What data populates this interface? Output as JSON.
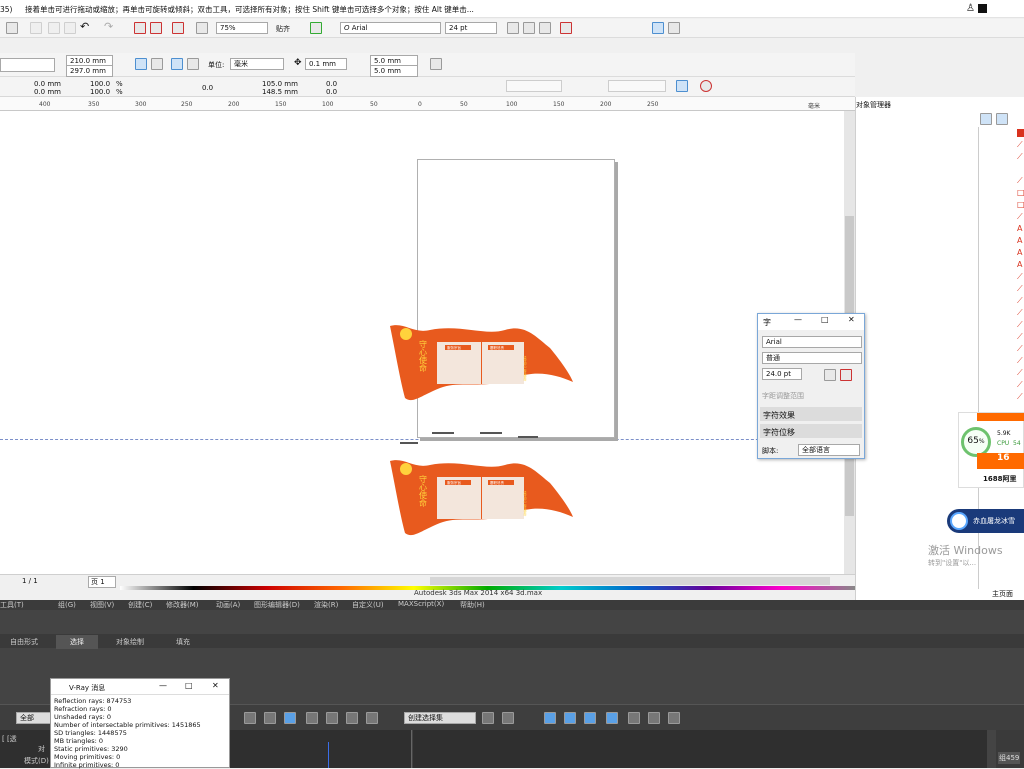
{
  "hint_bar": {
    "prefix": "35)",
    "text": "接着单击可进行拖动或缩放；再单击可旋转或倾斜；双击工具，可选择所有对象；按住 Shift 键单击可选择多个对象；按住 Alt 键单击..."
  },
  "toolbar1": {
    "zoom": "75%",
    "snap_label": "贴齐",
    "font": "Arial",
    "font_size": "24 pt",
    "font_glyph": "O"
  },
  "property_bar": {
    "width": "210.0 mm",
    "height": "297.0 mm",
    "units_label": "单位:",
    "units": "毫米",
    "nudge": "0.1 mm",
    "dup_x": "5.0 mm",
    "dup_y": "5.0 mm"
  },
  "toolbar3": {
    "x": "0.0 mm",
    "y": "0.0 mm",
    "sx": "100.0",
    "sy": "100.0",
    "pct": "%",
    "angle": "0.0",
    "px": "105.0 mm",
    "py": "148.5 mm",
    "r1": "0.0",
    "r2": "0.0"
  },
  "ruler": {
    "ticks": [
      "400",
      "350",
      "300",
      "250",
      "200",
      "150",
      "100",
      "50",
      "0",
      "50",
      "100",
      "150",
      "200",
      "250"
    ],
    "unit": "毫米"
  },
  "status": {
    "pages": "1 / 1",
    "page_tab": "页 1",
    "taskbar_text": "Autodesk 3ds Max  2014 x64     3d.max"
  },
  "char_panel": {
    "title": "字",
    "font": "Arial",
    "style": "普通",
    "size": "24.0 pt",
    "kerning_label": "字距调整范围",
    "section1": "字符效果",
    "section2": "字符位移",
    "script_label": "脚本:",
    "script_value": "全部语言"
  },
  "object_manager": {
    "title": "对象管理器",
    "bottom_label": "主页面"
  },
  "cpu_widget": {
    "percent": "65",
    "pct_sign": "%",
    "speed": "5.9K",
    "cpu_label": "CPU",
    "cpu_value": "54",
    "banner_text": "1688阿里",
    "banner_num": "16"
  },
  "activate": {
    "line1": "激活 Windows",
    "line2": "转到\"设置\"以..."
  },
  "game_pill": {
    "text": "赤血屠龙冰雪"
  },
  "max": {
    "menu": [
      "工具(T)",
      "组(G)",
      "视图(V)",
      "创建(C)",
      "修改器(M)",
      "动画(A)",
      "图形编辑器(D)",
      "渲染(R)",
      "自定义(U)",
      "MAXScript(X)",
      "帮助(H)"
    ],
    "tabs": [
      "自由形式",
      "选择",
      "对象绘制",
      "填充"
    ],
    "selection_set": "创建选择集",
    "filter": "全部",
    "left_labels": [
      "[ [透",
      "模式(D)",
      "对"
    ],
    "right_badge": "组459"
  },
  "vray": {
    "title": "V-Ray 消息",
    "lines": [
      "Reflection rays: 874753",
      "Refraction rays: 0",
      "Unshaded rays: 0",
      "Number of intersectable primitives: 1451865",
      "SD triangles: 1448575",
      "MB triangles: 0",
      "Static primitives: 3290",
      "Moving primitives: 0",
      "Infinite primitives: 0"
    ]
  },
  "flag": {
    "vertical_title": "守心使命",
    "box1_title": "服务宗旨",
    "box2_title": "履职尽责",
    "tail_text": "坚守初心 担当使命",
    "colors": {
      "flag": "#e85a1e",
      "text": "#ffd23c",
      "box": "#f3e6dc"
    }
  },
  "colors": {
    "accent": "#1c8bd1",
    "max_bg": "#444444",
    "objmgr_icon": "#d9321e"
  }
}
